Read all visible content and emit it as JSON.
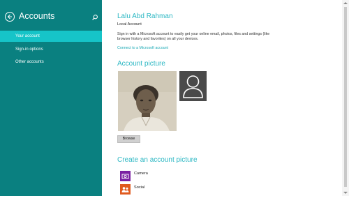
{
  "sidebar": {
    "title": "Accounts",
    "items": [
      {
        "label": "Your account",
        "active": true
      },
      {
        "label": "Sign-in options",
        "active": false
      },
      {
        "label": "Other accounts",
        "active": false
      }
    ],
    "colors": {
      "background": "#0a8080",
      "active": "#16c4c8"
    }
  },
  "account": {
    "name": "Lalu Abd Rahman",
    "type": "Local Account",
    "description": "Sign in with a Microsoft account to easily get your online email, photos, files and settings (like browser history and favorites) on all your devices.",
    "link": "Connect to a Microsoft account"
  },
  "picture_section": {
    "title": "Account picture",
    "browse_label": "Browse"
  },
  "create_section": {
    "title": "Create an account picture",
    "options": [
      {
        "label": "Camera",
        "icon": "camera-icon",
        "color": "#7a1fa2"
      },
      {
        "label": "Social",
        "icon": "people-icon",
        "color": "#e05a1e"
      }
    ]
  },
  "accent_color": "#2bb7c3"
}
